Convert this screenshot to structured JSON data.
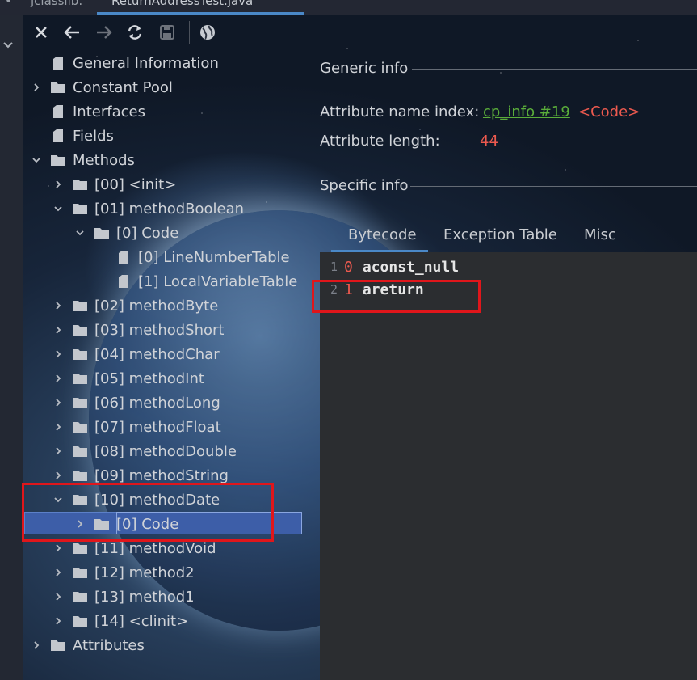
{
  "tabs": [
    {
      "label": "jclasslib:"
    },
    {
      "label": "ReturnAddressTest.java"
    }
  ],
  "tree": {
    "items": [
      {
        "label": "General Information",
        "depth": 0,
        "expand": "none",
        "icon": "file-icon"
      },
      {
        "label": "Constant Pool",
        "depth": 0,
        "expand": "collapsed",
        "icon": "folder-icon"
      },
      {
        "label": "Interfaces",
        "depth": 0,
        "expand": "none",
        "icon": "file-icon"
      },
      {
        "label": "Fields",
        "depth": 0,
        "expand": "none",
        "icon": "file-icon"
      },
      {
        "label": "Methods",
        "depth": 0,
        "expand": "expanded",
        "icon": "folder-icon"
      },
      {
        "label": "[00] <init>",
        "depth": 1,
        "expand": "collapsed",
        "icon": "folder-icon"
      },
      {
        "label": "[01] methodBoolean",
        "depth": 1,
        "expand": "expanded",
        "icon": "folder-icon"
      },
      {
        "label": "[0] Code",
        "depth": 2,
        "expand": "expanded",
        "icon": "folder-icon"
      },
      {
        "label": "[0] LineNumberTable",
        "depth": 3,
        "expand": "none",
        "icon": "file-icon"
      },
      {
        "label": "[1] LocalVariableTable",
        "depth": 3,
        "expand": "none",
        "icon": "file-icon"
      },
      {
        "label": "[02] methodByte",
        "depth": 1,
        "expand": "collapsed",
        "icon": "folder-icon"
      },
      {
        "label": "[03] methodShort",
        "depth": 1,
        "expand": "collapsed",
        "icon": "folder-icon"
      },
      {
        "label": "[04] methodChar",
        "depth": 1,
        "expand": "collapsed",
        "icon": "folder-icon"
      },
      {
        "label": "[05] methodInt",
        "depth": 1,
        "expand": "collapsed",
        "icon": "folder-icon"
      },
      {
        "label": "[06] methodLong",
        "depth": 1,
        "expand": "collapsed",
        "icon": "folder-icon"
      },
      {
        "label": "[07] methodFloat",
        "depth": 1,
        "expand": "collapsed",
        "icon": "folder-icon"
      },
      {
        "label": "[08] methodDouble",
        "depth": 1,
        "expand": "collapsed",
        "icon": "folder-icon"
      },
      {
        "label": "[09] methodString",
        "depth": 1,
        "expand": "collapsed",
        "icon": "folder-icon"
      },
      {
        "label": "[10] methodDate",
        "depth": 1,
        "expand": "expanded",
        "icon": "folder-icon"
      },
      {
        "label": "[0] Code",
        "depth": 2,
        "expand": "collapsed",
        "icon": "folder-icon",
        "selected": true
      },
      {
        "label": "[11] methodVoid",
        "depth": 1,
        "expand": "collapsed",
        "icon": "folder-icon"
      },
      {
        "label": "[12] method2",
        "depth": 1,
        "expand": "collapsed",
        "icon": "folder-icon"
      },
      {
        "label": "[13] method1",
        "depth": 1,
        "expand": "collapsed",
        "icon": "folder-icon"
      },
      {
        "label": "[14] <clinit>",
        "depth": 1,
        "expand": "collapsed",
        "icon": "folder-icon"
      },
      {
        "label": "Attributes",
        "depth": 0,
        "expand": "collapsed",
        "icon": "folder-icon"
      }
    ]
  },
  "generic": {
    "title": "Generic info",
    "name_index_label": "Attribute name index:",
    "name_index_link": "cp_info #19",
    "name_index_value": "<Code>",
    "length_label": "Attribute length:",
    "length_value": "44"
  },
  "specific": {
    "title": "Specific info",
    "tabs": [
      "Bytecode",
      "Exception Table",
      "Misc"
    ]
  },
  "bytecode": [
    {
      "line": "1",
      "offset": "0",
      "instruction": "aconst_null"
    },
    {
      "line": "2",
      "offset": "1",
      "instruction": "areturn"
    }
  ],
  "colors": {
    "accent": "#4a88c7",
    "selection": "#3d5ea8",
    "highlight_box": "#e0161b",
    "link": "#5aad3a",
    "value_red": "#ee5a4f"
  }
}
